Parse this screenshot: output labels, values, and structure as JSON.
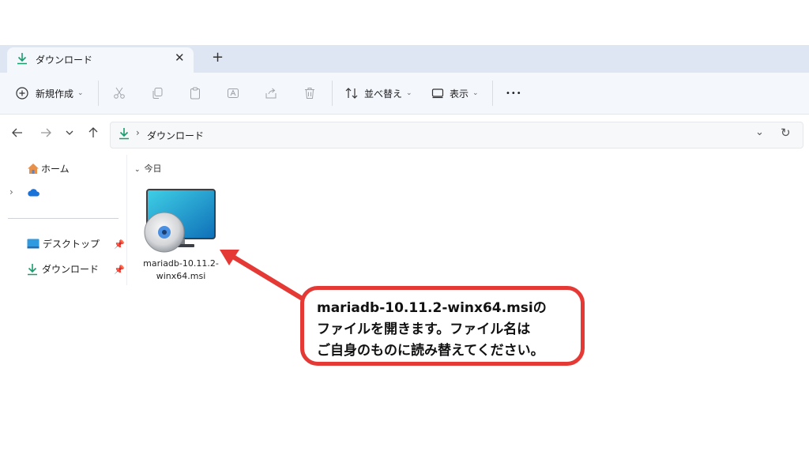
{
  "tab": {
    "title": "ダウンロード",
    "close": "✕",
    "new_tab": "+"
  },
  "toolbar": {
    "new_label": "新規作成",
    "sort_label": "並べ替え",
    "view_label": "表示",
    "more_label": "•••"
  },
  "address": {
    "crumb": "ダウンロード"
  },
  "sidebar": {
    "home_label": "ホーム",
    "desktop_label": "デスクトップ",
    "downloads_label": "ダウンロード"
  },
  "content": {
    "group_label": "今日",
    "file_line1": "mariadb-10.11.2-",
    "file_line2": "winx64.msi"
  },
  "callout": {
    "line1": "mariadb-10.11.2-winx64.msiの",
    "line2": "ファイルを開きます。ファイル名は",
    "line3": "ご自身のものに読み替えてください。"
  },
  "colors": {
    "accent_green": "#1a9d6c",
    "callout_red": "#e53935",
    "tabbar_bg": "#dfe6f3"
  }
}
